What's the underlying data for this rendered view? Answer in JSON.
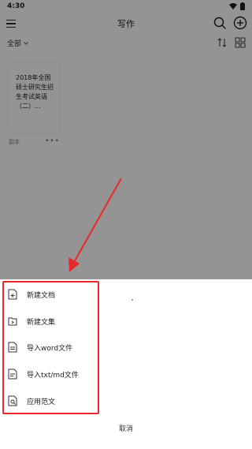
{
  "status_bar": {
    "time": "4:30"
  },
  "app_bar": {
    "title": "写作"
  },
  "filter": {
    "label": "全部"
  },
  "document": {
    "title": "2018年全国硕士研究生招生考试英语（二）...",
    "meta": "副本"
  },
  "sheet": {
    "items": [
      {
        "label": "新建文档",
        "icon": "new-document-icon"
      },
      {
        "label": "新建文集",
        "icon": "new-folder-icon"
      },
      {
        "label": "导入word文件",
        "icon": "import-word-icon"
      },
      {
        "label": "导入txt/md文件",
        "icon": "import-txt-icon"
      },
      {
        "label": "应用范文",
        "icon": "template-icon"
      }
    ],
    "cancel": "取消"
  },
  "colors": {
    "highlight": "#e8282b",
    "overlay": "rgba(0,0,0,0.42)"
  }
}
